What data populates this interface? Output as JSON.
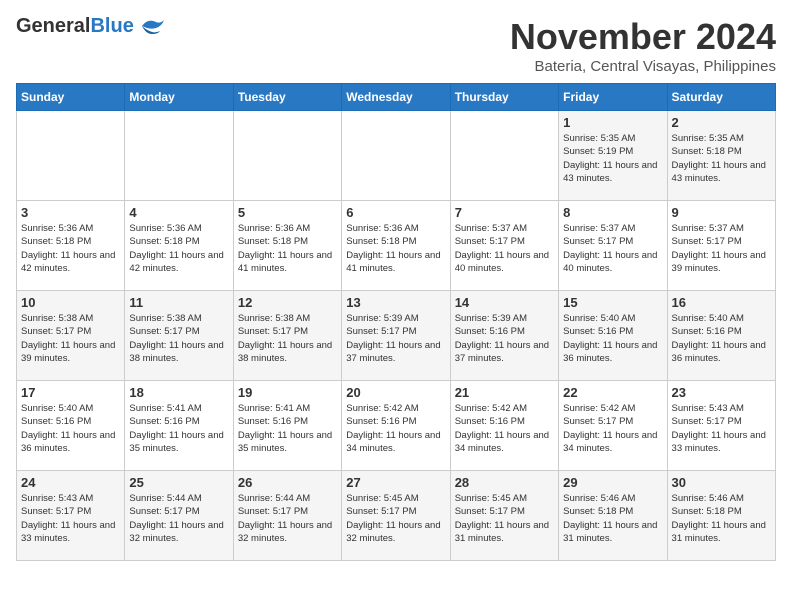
{
  "header": {
    "logo_general": "General",
    "logo_blue": "Blue",
    "month": "November 2024",
    "location": "Bateria, Central Visayas, Philippines"
  },
  "days_of_week": [
    "Sunday",
    "Monday",
    "Tuesday",
    "Wednesday",
    "Thursday",
    "Friday",
    "Saturday"
  ],
  "weeks": [
    [
      {
        "day": "",
        "info": ""
      },
      {
        "day": "",
        "info": ""
      },
      {
        "day": "",
        "info": ""
      },
      {
        "day": "",
        "info": ""
      },
      {
        "day": "",
        "info": ""
      },
      {
        "day": "1",
        "info": "Sunrise: 5:35 AM\nSunset: 5:19 PM\nDaylight: 11 hours and 43 minutes."
      },
      {
        "day": "2",
        "info": "Sunrise: 5:35 AM\nSunset: 5:18 PM\nDaylight: 11 hours and 43 minutes."
      }
    ],
    [
      {
        "day": "3",
        "info": "Sunrise: 5:36 AM\nSunset: 5:18 PM\nDaylight: 11 hours and 42 minutes."
      },
      {
        "day": "4",
        "info": "Sunrise: 5:36 AM\nSunset: 5:18 PM\nDaylight: 11 hours and 42 minutes."
      },
      {
        "day": "5",
        "info": "Sunrise: 5:36 AM\nSunset: 5:18 PM\nDaylight: 11 hours and 41 minutes."
      },
      {
        "day": "6",
        "info": "Sunrise: 5:36 AM\nSunset: 5:18 PM\nDaylight: 11 hours and 41 minutes."
      },
      {
        "day": "7",
        "info": "Sunrise: 5:37 AM\nSunset: 5:17 PM\nDaylight: 11 hours and 40 minutes."
      },
      {
        "day": "8",
        "info": "Sunrise: 5:37 AM\nSunset: 5:17 PM\nDaylight: 11 hours and 40 minutes."
      },
      {
        "day": "9",
        "info": "Sunrise: 5:37 AM\nSunset: 5:17 PM\nDaylight: 11 hours and 39 minutes."
      }
    ],
    [
      {
        "day": "10",
        "info": "Sunrise: 5:38 AM\nSunset: 5:17 PM\nDaylight: 11 hours and 39 minutes."
      },
      {
        "day": "11",
        "info": "Sunrise: 5:38 AM\nSunset: 5:17 PM\nDaylight: 11 hours and 38 minutes."
      },
      {
        "day": "12",
        "info": "Sunrise: 5:38 AM\nSunset: 5:17 PM\nDaylight: 11 hours and 38 minutes."
      },
      {
        "day": "13",
        "info": "Sunrise: 5:39 AM\nSunset: 5:17 PM\nDaylight: 11 hours and 37 minutes."
      },
      {
        "day": "14",
        "info": "Sunrise: 5:39 AM\nSunset: 5:16 PM\nDaylight: 11 hours and 37 minutes."
      },
      {
        "day": "15",
        "info": "Sunrise: 5:40 AM\nSunset: 5:16 PM\nDaylight: 11 hours and 36 minutes."
      },
      {
        "day": "16",
        "info": "Sunrise: 5:40 AM\nSunset: 5:16 PM\nDaylight: 11 hours and 36 minutes."
      }
    ],
    [
      {
        "day": "17",
        "info": "Sunrise: 5:40 AM\nSunset: 5:16 PM\nDaylight: 11 hours and 36 minutes."
      },
      {
        "day": "18",
        "info": "Sunrise: 5:41 AM\nSunset: 5:16 PM\nDaylight: 11 hours and 35 minutes."
      },
      {
        "day": "19",
        "info": "Sunrise: 5:41 AM\nSunset: 5:16 PM\nDaylight: 11 hours and 35 minutes."
      },
      {
        "day": "20",
        "info": "Sunrise: 5:42 AM\nSunset: 5:16 PM\nDaylight: 11 hours and 34 minutes."
      },
      {
        "day": "21",
        "info": "Sunrise: 5:42 AM\nSunset: 5:16 PM\nDaylight: 11 hours and 34 minutes."
      },
      {
        "day": "22",
        "info": "Sunrise: 5:42 AM\nSunset: 5:17 PM\nDaylight: 11 hours and 34 minutes."
      },
      {
        "day": "23",
        "info": "Sunrise: 5:43 AM\nSunset: 5:17 PM\nDaylight: 11 hours and 33 minutes."
      }
    ],
    [
      {
        "day": "24",
        "info": "Sunrise: 5:43 AM\nSunset: 5:17 PM\nDaylight: 11 hours and 33 minutes."
      },
      {
        "day": "25",
        "info": "Sunrise: 5:44 AM\nSunset: 5:17 PM\nDaylight: 11 hours and 32 minutes."
      },
      {
        "day": "26",
        "info": "Sunrise: 5:44 AM\nSunset: 5:17 PM\nDaylight: 11 hours and 32 minutes."
      },
      {
        "day": "27",
        "info": "Sunrise: 5:45 AM\nSunset: 5:17 PM\nDaylight: 11 hours and 32 minutes."
      },
      {
        "day": "28",
        "info": "Sunrise: 5:45 AM\nSunset: 5:17 PM\nDaylight: 11 hours and 31 minutes."
      },
      {
        "day": "29",
        "info": "Sunrise: 5:46 AM\nSunset: 5:18 PM\nDaylight: 11 hours and 31 minutes."
      },
      {
        "day": "30",
        "info": "Sunrise: 5:46 AM\nSunset: 5:18 PM\nDaylight: 11 hours and 31 minutes."
      }
    ]
  ]
}
